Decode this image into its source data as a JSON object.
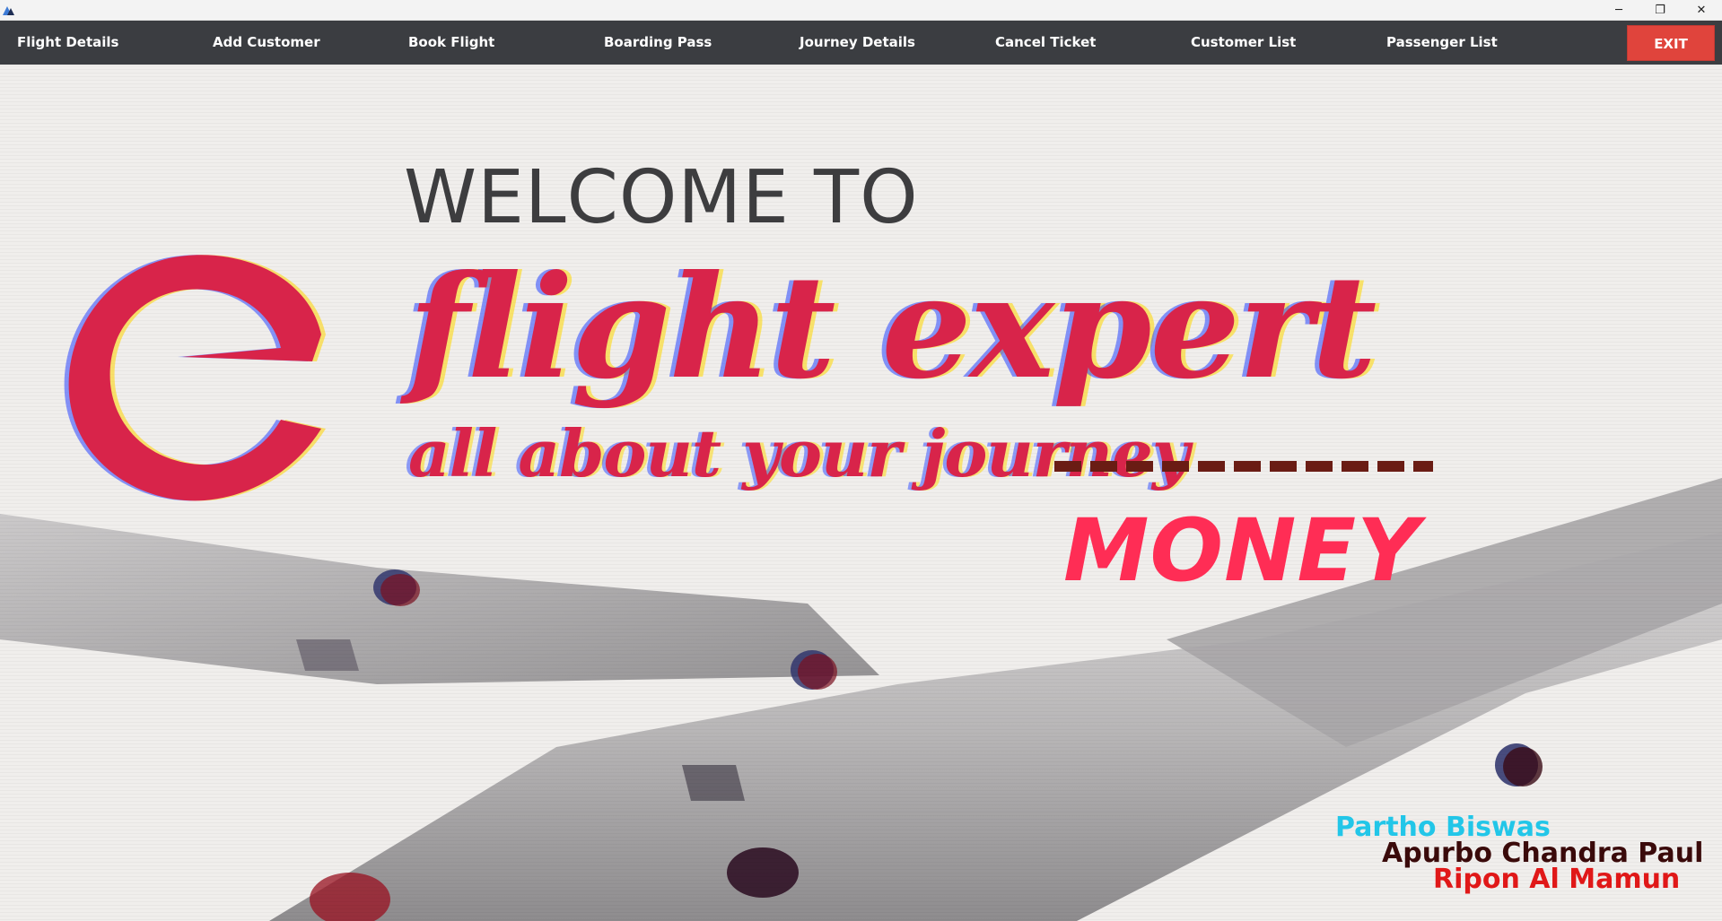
{
  "window": {
    "app_icon": "triangle-logo-icon",
    "controls": {
      "minimize": "─",
      "maximize": "❐",
      "close": "✕"
    }
  },
  "menu": {
    "items": [
      {
        "label": "Flight Details"
      },
      {
        "label": "Add Customer"
      },
      {
        "label": "Book Flight"
      },
      {
        "label": "Boarding Pass"
      },
      {
        "label": "Journey Details"
      },
      {
        "label": "Cancel Ticket"
      },
      {
        "label": "Customer List"
      },
      {
        "label": "Passenger List"
      }
    ],
    "exit_label": "EXIT"
  },
  "hero": {
    "welcome": "WELCOME TO",
    "brand": "flight expert",
    "tagline": "all about your journey",
    "money": "MONEY",
    "credits": [
      "Partho Biswas",
      "Apurbo Chandra Paul",
      "Ripon Al Mamun"
    ]
  },
  "colors": {
    "menu_bg": "#3b3d41",
    "exit_bg": "#e0443c",
    "brand": "#d8244a",
    "money": "#ff2d55",
    "credit_1": "#22c6e8",
    "credit_2": "#3a0a0a",
    "credit_3": "#e01818"
  }
}
